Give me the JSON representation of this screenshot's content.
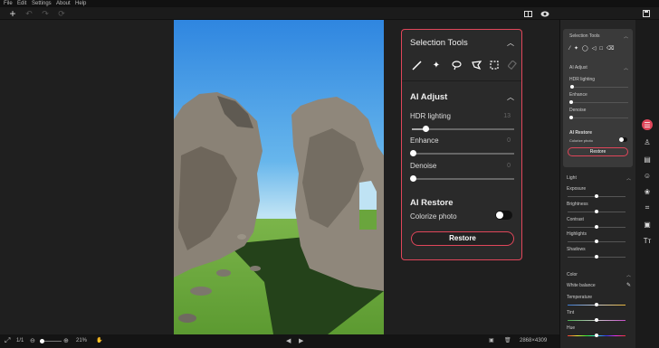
{
  "menu": [
    "File",
    "Edit",
    "Settings",
    "About",
    "Help"
  ],
  "toolbar": {
    "left_icons": [
      "plus-icon",
      "undo-icon",
      "redo-icon",
      "reset-icon"
    ],
    "right_icons": [
      "compare-icon",
      "eye-icon",
      "save-icon"
    ]
  },
  "bottom": {
    "page": "1/1",
    "zoom": "21%",
    "zoom_level": 0.21,
    "dimensions": "2868×4309"
  },
  "zoom_panel": {
    "selection_title": "Selection Tools",
    "ai_adjust_title": "AI Adjust",
    "hdr_label": "HDR lighting",
    "hdr_value": "13",
    "enhance_label": "Enhance",
    "enhance_value": "0",
    "denoise_label": "Denoise",
    "denoise_value": "0",
    "ai_restore_title": "AI Restore",
    "colorize_label": "Colorize photo",
    "restore_button": "Restore"
  },
  "right_panel": {
    "selection_title": "Selection Tools",
    "ai_adjust_title": "AI Adjust",
    "hdr_label": "HDR lighting",
    "enhance_label": "Enhance",
    "denoise_label": "Denoise",
    "ai_restore_title": "AI Restore",
    "colorize_label": "Colorize photo",
    "restore_button": "Restore",
    "light_title": "Light",
    "exposure": "Exposure",
    "brightness": "Brightness",
    "contrast": "Contrast",
    "highlights": "Highlights",
    "shadows": "Shadows",
    "color_title": "Color",
    "white_balance": "White balance",
    "temperature": "Temperature",
    "tint": "Tint",
    "hue": "Hue"
  },
  "colors": {
    "accent": "#e0465a",
    "panel": "#2a2a2a",
    "background": "#1b1b1b"
  }
}
